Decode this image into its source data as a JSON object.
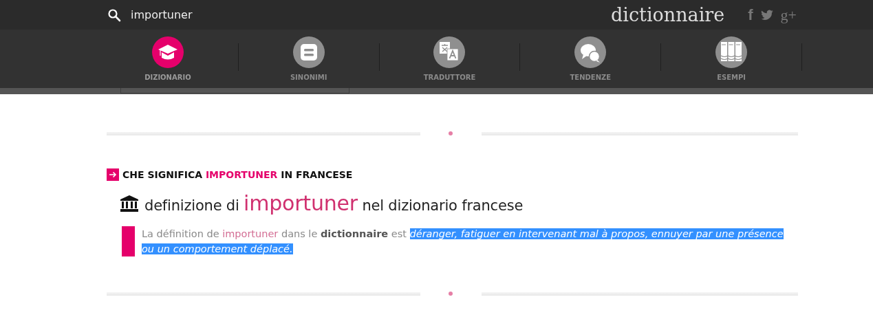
{
  "search": {
    "value": "importuner"
  },
  "logo": "dictionnaire",
  "social": [
    {
      "kind": "facebook",
      "glyph": "f"
    },
    {
      "kind": "twitter"
    },
    {
      "kind": "gplus",
      "glyph": "g+"
    }
  ],
  "nav": [
    {
      "label": "DIZIONARIO",
      "kind": "cap",
      "selected": true
    },
    {
      "label": "SINONIMI",
      "kind": "equals",
      "selected": false
    },
    {
      "label": "TRADUTTORE",
      "kind": "translate",
      "selected": false
    },
    {
      "label": "TENDENZE",
      "kind": "chat",
      "selected": false
    },
    {
      "label": "ESEMPI",
      "kind": "books",
      "selected": false
    }
  ],
  "heading": [
    {
      "kind": "plain",
      "text": "CHE SIGNIFICA "
    },
    {
      "kind": "term",
      "text": "IMPORTUNER"
    },
    {
      "kind": "plain",
      "text": " IN FRANCESE"
    }
  ],
  "subheading": [
    {
      "kind": "plain",
      "text": "definizione di "
    },
    {
      "kind": "term",
      "text": "importuner"
    },
    {
      "kind": "plain",
      "text": " nel dizionario francese"
    }
  ],
  "definition": [
    {
      "kind": "plain",
      "text": "La définition de "
    },
    {
      "kind": "term",
      "text": "importuner"
    },
    {
      "kind": "plain",
      "text": " dans le "
    },
    {
      "kind": "bold",
      "text": "dictionnaire"
    },
    {
      "kind": "plain",
      "text": " est "
    },
    {
      "kind": "selected",
      "text": "déranger, fatiguer en intervenant mal à propos, ennuyer par une présence ou un comportement déplacé."
    }
  ]
}
